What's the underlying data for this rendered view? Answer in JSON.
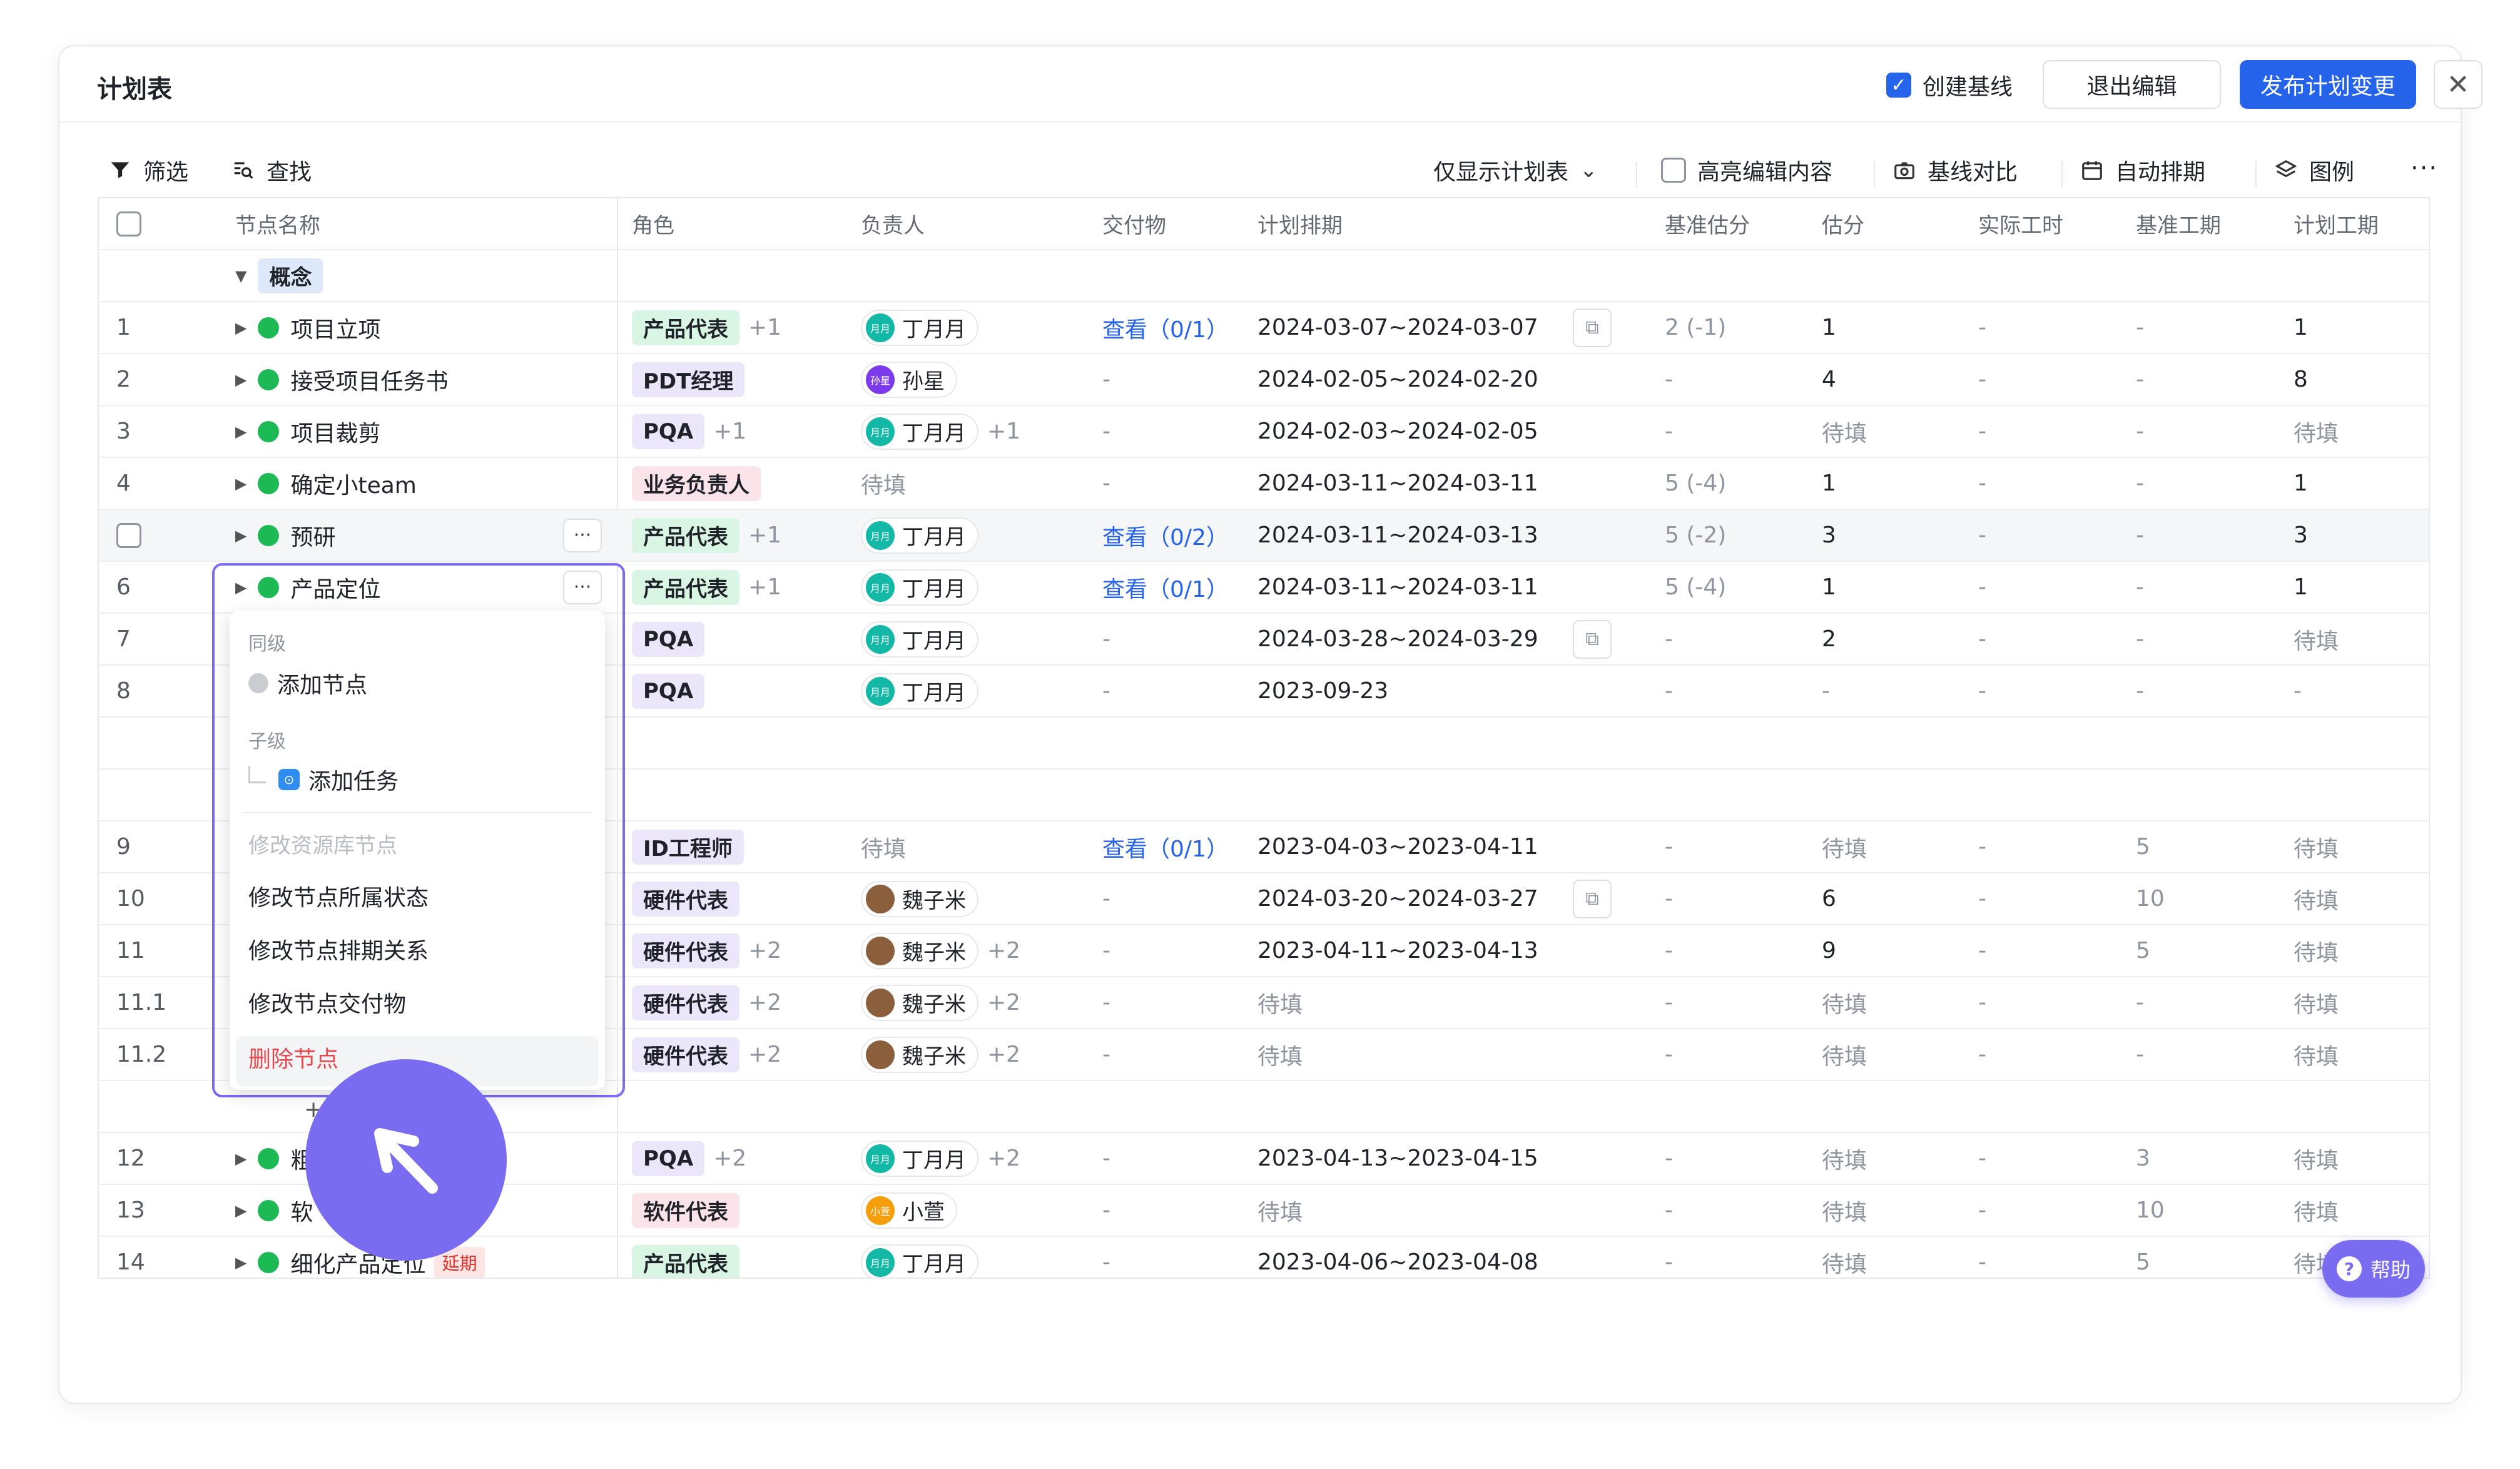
{
  "header": {
    "title": "计划表",
    "create_baseline": "创建基线",
    "exit_edit": "退出编辑",
    "publish": "发布计划变更",
    "close": "✕"
  },
  "toolbar": {
    "filter": "筛选",
    "search": "查找",
    "view_select": "仅显示计划表",
    "highlight": "高亮编辑内容",
    "baseline_compare": "基线对比",
    "auto_schedule": "自动排期",
    "legend": "图例",
    "more": "···"
  },
  "columns": [
    "节点名称",
    "角色",
    "负责人",
    "交付物",
    "计划排期",
    "基准估分",
    "估分",
    "实际工时",
    "基准工期",
    "计划工期"
  ],
  "group": {
    "label": "概念"
  },
  "rows": [
    {
      "idx": "1",
      "name": "项目立项",
      "role": "产品代表",
      "role_plus": "+1",
      "owner": "丁月月",
      "av": "月月",
      "owner_plus": "",
      "deliver": "查看（0/1）",
      "schedule": "2024-03-07~2024-03-07",
      "base_score": "2 (-1)",
      "score": "1",
      "actual": "-",
      "base_period": "-",
      "plan_period": "1"
    },
    {
      "idx": "2",
      "name": "接受项目任务书",
      "role": "PDT经理",
      "role_plus": "",
      "owner": "孙星",
      "av": "孙星",
      "owner_plus": "",
      "deliver": "-",
      "schedule": "2024-02-05~2024-02-20",
      "base_score": "-",
      "score": "4",
      "actual": "-",
      "base_period": "-",
      "plan_period": "8"
    },
    {
      "idx": "3",
      "name": "项目裁剪",
      "role": "PQA",
      "role_plus": "+1",
      "owner": "丁月月",
      "av": "月月",
      "owner_plus": "+1",
      "deliver": "-",
      "schedule": "2024-02-03~2024-02-05",
      "base_score": "-",
      "score": "待填",
      "actual": "-",
      "base_period": "-",
      "plan_period": "待填"
    },
    {
      "idx": "4",
      "name": "确定小team",
      "role": "业务负责人",
      "role_plus": "",
      "owner": "待填",
      "av": "",
      "owner_plus": "",
      "deliver": "-",
      "schedule": "2024-03-11~2024-03-11",
      "base_score": "5 (-4)",
      "score": "1",
      "actual": "-",
      "base_period": "-",
      "plan_period": "1"
    },
    {
      "idx": "",
      "name": "预研",
      "role": "产品代表",
      "role_plus": "+1",
      "owner": "丁月月",
      "av": "月月",
      "owner_plus": "",
      "deliver": "查看（0/2）",
      "schedule": "2024-03-11~2024-03-13",
      "base_score": "5 (-2)",
      "score": "3",
      "actual": "-",
      "base_period": "-",
      "plan_period": "3"
    },
    {
      "idx": "6",
      "name": "产品定位",
      "role": "产品代表",
      "role_plus": "+1",
      "owner": "丁月月",
      "av": "月月",
      "owner_plus": "",
      "deliver": "查看（0/1）",
      "schedule": "2024-03-11~2024-03-11",
      "base_score": "5 (-4)",
      "score": "1",
      "actual": "-",
      "base_period": "-",
      "plan_period": "1"
    },
    {
      "idx": "7",
      "name": "",
      "role": "PQA",
      "role_plus": "",
      "owner": "丁月月",
      "av": "月月",
      "owner_plus": "",
      "deliver": "-",
      "schedule": "2024-03-28~2024-03-29",
      "base_score": "-",
      "score": "2",
      "actual": "-",
      "base_period": "-",
      "plan_period": "待填"
    },
    {
      "idx": "8",
      "name": "",
      "role": "PQA",
      "role_plus": "",
      "owner": "丁月月",
      "av": "月月",
      "owner_plus": "",
      "deliver": "-",
      "schedule": "2023-09-23",
      "base_score": "-",
      "score": "-",
      "actual": "-",
      "base_period": "-",
      "plan_period": "-"
    },
    {
      "idx": "9",
      "name": "",
      "role": "ID工程师",
      "role_plus": "",
      "owner": "待填",
      "av": "",
      "owner_plus": "",
      "deliver": "查看（0/1）",
      "schedule": "2023-04-03~2023-04-11",
      "base_score": "-",
      "score": "待填",
      "actual": "-",
      "base_period": "5",
      "plan_period": "待填"
    },
    {
      "idx": "10",
      "name": "",
      "role": "硬件代表",
      "role_plus": "",
      "owner": "魏子米",
      "av": "",
      "owner_plus": "",
      "deliver": "-",
      "schedule": "2024-03-20~2024-03-27",
      "base_score": "-",
      "score": "6",
      "actual": "-",
      "base_period": "10",
      "plan_period": "待填"
    },
    {
      "idx": "11",
      "name": "",
      "role": "硬件代表",
      "role_plus": "+2",
      "owner": "魏子米",
      "av": "",
      "owner_plus": "+2",
      "deliver": "-",
      "schedule": "2023-04-11~2023-04-13",
      "base_score": "-",
      "score": "9",
      "actual": "-",
      "base_period": "5",
      "plan_period": "待填"
    },
    {
      "idx": "11.1",
      "name": "",
      "role": "硬件代表",
      "role_plus": "+2",
      "owner": "魏子米",
      "av": "",
      "owner_plus": "+2",
      "deliver": "-",
      "schedule": "待填",
      "base_score": "-",
      "score": "待填",
      "actual": "-",
      "base_period": "-",
      "plan_period": "待填"
    },
    {
      "idx": "11.2",
      "name": "",
      "role": "硬件代表",
      "role_plus": "+2",
      "owner": "魏子米",
      "av": "",
      "owner_plus": "+2",
      "deliver": "-",
      "schedule": "待填",
      "base_score": "-",
      "score": "待填",
      "actual": "-",
      "base_period": "-",
      "plan_period": "待填"
    },
    {
      "idx": "12",
      "name": "粗",
      "role": "PQA",
      "role_plus": "+2",
      "owner": "丁月月",
      "av": "月月",
      "owner_plus": "+2",
      "deliver": "-",
      "schedule": "2023-04-13~2023-04-15",
      "base_score": "-",
      "score": "待填",
      "actual": "-",
      "base_period": "3",
      "plan_period": "待填"
    },
    {
      "idx": "13",
      "name": "软",
      "role": "软件代表",
      "role_plus": "",
      "owner": "小萱",
      "av": "小萱",
      "owner_plus": "",
      "deliver": "-",
      "schedule": "待填",
      "base_score": "-",
      "score": "待填",
      "actual": "-",
      "base_period": "10",
      "plan_period": "待填"
    },
    {
      "idx": "14",
      "name": "细化产品定位",
      "role": "产品代表",
      "role_plus": "",
      "owner": "丁月月",
      "av": "月月",
      "owner_plus": "",
      "deliver": "-",
      "schedule": "2023-04-06~2023-04-08",
      "base_score": "-",
      "score": "待填",
      "actual": "-",
      "base_period": "5",
      "plan_period": "待填"
    }
  ],
  "delay_label": "延期",
  "context_menu": {
    "sibling": "同级",
    "add_node": "添加节点",
    "child": "子级",
    "add_task": "添加任务",
    "edit_resource": "修改资源库节点",
    "edit_status": "修改节点所属状态",
    "edit_schedule_rel": "修改节点排期关系",
    "edit_deliverable": "修改节点交付物",
    "delete": "删除节点"
  },
  "help": "帮助"
}
